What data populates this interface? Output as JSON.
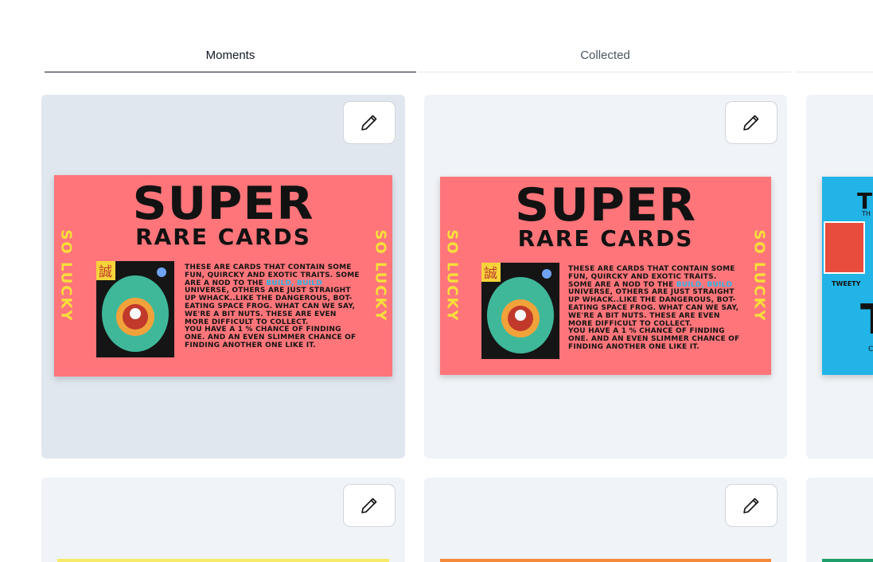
{
  "tabs": [
    {
      "label": "Moments",
      "active": true
    },
    {
      "label": "Collected",
      "active": false
    }
  ],
  "cards": [
    {
      "name": "moment-card-1",
      "edit_label": "Edit",
      "art": {
        "title_line1": "SUPER",
        "title_line2": "RARE CARDS",
        "side_left": "SO LUCKY",
        "side_right": "SO LUCKY",
        "desc_before": "These are cards that contain some fun, quircky and exotic traits. Some are a nod to the ",
        "desc_highlight": "Build, Build",
        "desc_after": " universe, others are just straight up whack..like the dangerous, bot-eating space frog. What can we say, we're a bit nuts. These are even more difficult to collect.",
        "desc_chance": "You have a 1 % chance of finding one. and an even slimmer chance of finding another one like it.",
        "stamp": "誠"
      }
    },
    {
      "name": "moment-card-2",
      "edit_label": "Edit",
      "art": {
        "title_line1": "SUPER",
        "title_line2": "RARE CARDS",
        "side_left": "SO LUCKY",
        "side_right": "SO LUCKY",
        "desc_before": "These are cards that contain some fun, quircky and exotic traits. Some are a nod to the ",
        "desc_highlight": "Build, Build",
        "desc_after": " universe, others are just straight up whack..like the dangerous, bot-eating space frog. What can we say, we're a bit nuts. These are even more difficult to collect.",
        "desc_chance": "You have a 1 % chance of finding one. and an even slimmer chance of finding another one like it.",
        "stamp": "誠"
      }
    },
    {
      "name": "moment-card-3",
      "art": {
        "title": "T",
        "subtitle": "TH",
        "big": "T",
        "label": "TWEETY",
        "tail": "C"
      }
    }
  ],
  "colors": {
    "card_bg": "#f0f3f7",
    "card_bg_hover": "#e1e7ef",
    "art_pink": "#ff757a",
    "art_blue": "#22b4e6",
    "art_side_text": "#f6e03a",
    "art_highlight": "#29b6e8",
    "strip_yellow": "#f7ea6a",
    "strip_orange": "#f58a3b",
    "strip_green": "#1e9e6a"
  },
  "icons": {
    "edit": "pencil-icon"
  }
}
